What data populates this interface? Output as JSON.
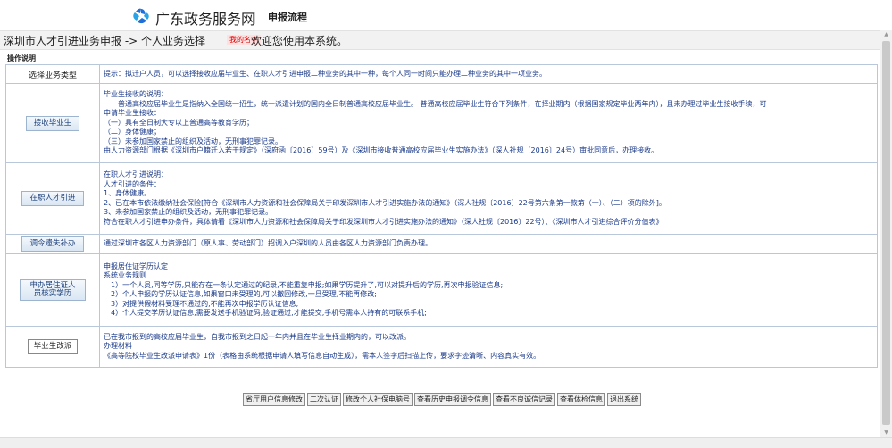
{
  "header": {
    "site_name": "广东政务服务网",
    "title": "申报流程"
  },
  "breadcrumb": {
    "path": "深圳市人才引进业务申报 -> 个人业务选择",
    "username": "我的名字",
    "welcome": "欢迎您使用本系统。"
  },
  "section_title": "操作说明",
  "table": {
    "intro": {
      "label": "选择业务类型",
      "text": "提示：拟迁户人员，可以选择接收应届毕业生、在职人才引进申报二种业务的其中一种，每个人同一时间只能办理二种业务的其中一项业务。"
    },
    "rows": [
      {
        "label": "接收毕业生",
        "lines": [
          "毕业生接收的说明：",
          "　　普通高校应届毕业生是指纳入全国统一招生，统一派遣计划的国内全日制普通高校应届毕业生。 普通高校应届毕业生符合下列条件，在择业期内（根据国家规定毕业两年内），且未办理过毕业生接收手续，可",
          "申请毕业生接收：",
          "（一）具有全日制大专以上普通高等教育学历；",
          "（二）身体健康；",
          "（三）未参加国家禁止的组织及活动，无刑事犯罪记录。",
          "由人力资源部门根据《深圳市户籍迁入若干规定》（深府函〔2016〕59号）及《深圳市接收普通高校应届毕业生实施办法》（深人社规〔2016〕24号）审批同意后，办理接收。"
        ]
      },
      {
        "label": "在职人才引进",
        "lines": [
          "在职人才引进说明：",
          "人才引进的条件：",
          "1、身体健康。",
          "2、已在本市依法缴纳社会保险[符合《深圳市人力资源和社会保障局关于印发深圳市人才引进实施办法的通知》（深人社规〔2016〕22号第六条第一款第（一）、（二）项的除外]。",
          "3、未参加国家禁止的组织及活动，无刑事犯罪记录。",
          "符合在职人才引进申办条件，具体请看《深圳市人力资源和社会保障局关于印发深圳市人才引进实施办法的通知》（深人社规〔2016〕22号）、《深圳市人才引进综合评价分值表》"
        ]
      },
      {
        "label": "调令遗失补办",
        "lines": [
          "通过深圳市各区人力资源部门（原人事、劳动部门）招调入户深圳的人员由各区人力资源部门负责办理。"
        ]
      },
      {
        "label": "申办居住证人员核实学历",
        "lines": [
          "申报居住证学历认定",
          "系统业务规则",
          "　1）一个人员,同等学历,只能存在一条认定通过的纪录,不能重复申报;如果学历提升了,可以对提升后的学历,再次申报验证信息;",
          "　2）个人申报的学历认证信息,如果窗口未受理的,可以撤回修改,一旦受理,不能再修改;",
          "　3）对提供假材料受理不通过的,不能再次申报学历认证信息;",
          "　4）个人提交学历认证信息,需要发送手机验证码,验证通过,才能提交,手机号需本人持有的可联系手机;"
        ]
      },
      {
        "label": "毕业生改派",
        "lines": [
          "已在我市报到的高校应届毕业生，自我市报到之日起一年内并且在毕业生择业期内的，可以改派。",
          "办理材料",
          "《高等院校毕业生改派申请表》1份（表格由系统根据申请人填写信息自动生成），需本人签字后扫描上传，要求字迹清晰、内容真实有效。"
        ]
      }
    ]
  },
  "actions": [
    "省厅用户信息修改",
    "二次认证",
    "修改个人社保电脑号",
    "查看历史申报调令信息",
    "查看不良诚信记录",
    "查看体检信息",
    "退出系统"
  ]
}
